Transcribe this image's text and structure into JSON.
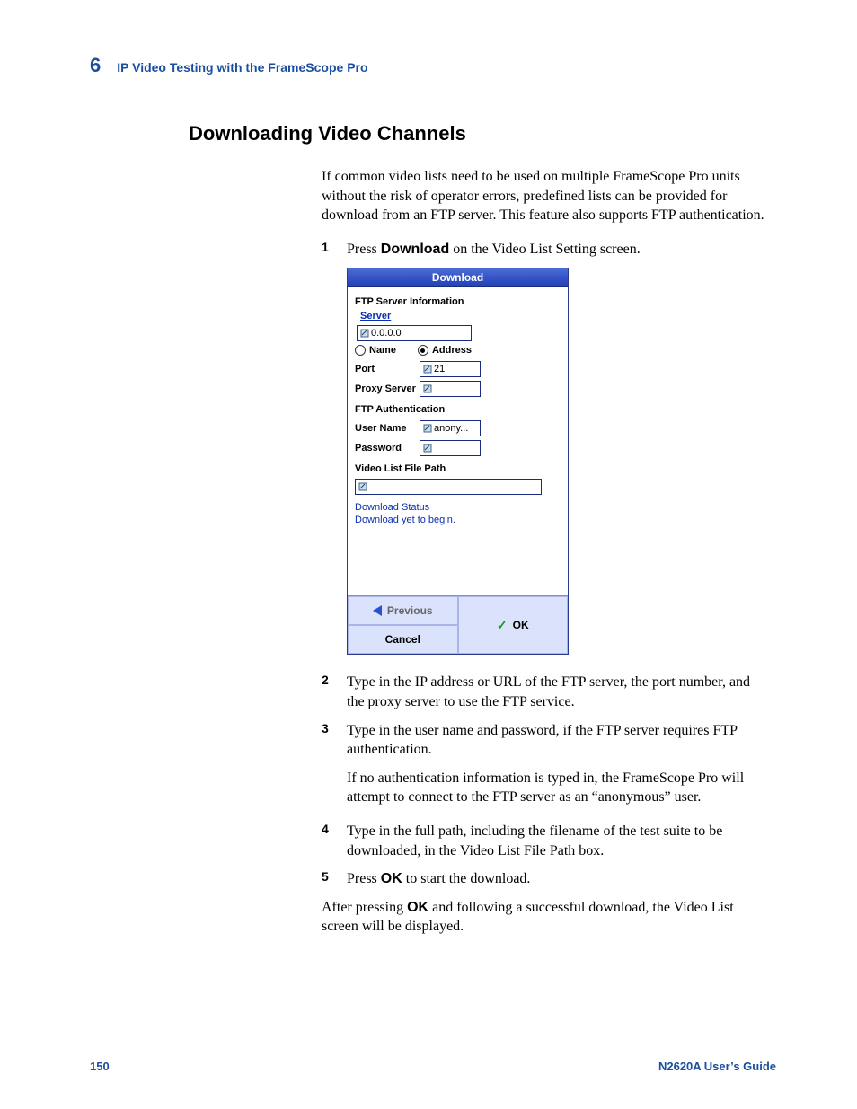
{
  "header": {
    "chapter_num": "6",
    "chapter_title": "IP Video Testing with the FrameScope Pro"
  },
  "section_heading": "Downloading Video Channels",
  "intro": "If common video lists need to be used on multiple FrameScope Pro units without the risk of operator errors, predefined lists can be provided for download from an FTP server. This feature also supports FTP authentication.",
  "step1_prefix": "Press ",
  "step1_bold": "Download",
  "step1_suffix": " on the Video List Setting screen.",
  "device": {
    "title": "Download",
    "ftp_info_legend": "FTP Server Information",
    "server_link": "Server",
    "server_value": "0.0.0.0",
    "radio_name": "Name",
    "radio_address": "Address",
    "port_label": "Port",
    "port_value": "21",
    "proxy_label": "Proxy Server",
    "proxy_value": "",
    "auth_legend": "FTP Authentication",
    "user_label": "User Name",
    "user_value": "anony...",
    "pass_label": "Password",
    "pass_value": "",
    "path_legend": "Video List File Path",
    "path_value": "",
    "status_legend": "Download Status",
    "status_text": "Download yet to begin.",
    "btn_previous": "Previous",
    "btn_cancel": "Cancel",
    "btn_ok": "OK"
  },
  "step2": "Type in the IP address or URL of the FTP server, the port number, and the proxy server to use the FTP service.",
  "step3": "Type in the user name and password, if the FTP server requires FTP authentication.",
  "step3_note": "If no authentication information is typed in, the FrameScope Pro will attempt to connect to the FTP server as an “anonymous” user.",
  "step4": "Type in the full path, including the filename of the test suite to be downloaded, in the Video List File Path box.",
  "step5_prefix": "Press ",
  "step5_bold": "OK",
  "step5_suffix": " to start the download.",
  "closing_prefix": "After pressing ",
  "closing_bold": "OK",
  "closing_suffix": " and following a successful download, the Video List screen will be displayed.",
  "footer": {
    "page_num": "150",
    "doc_title": "N2620A User’s Guide"
  }
}
